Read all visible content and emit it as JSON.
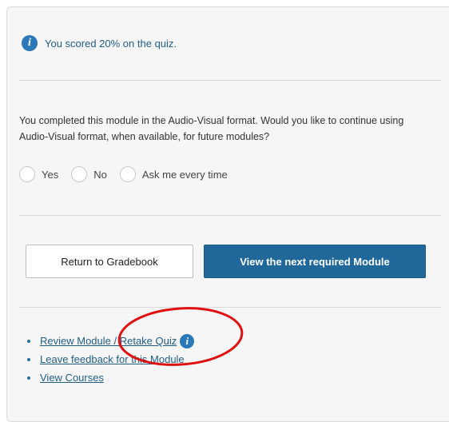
{
  "quiz": {
    "score_text": "You scored 20% on the quiz.",
    "info_icon": "info-icon"
  },
  "format_question": {
    "text": "You completed this module in the Audio-Visual format. Would you like to continue using Audio-Visual format, when available, for future modules?",
    "options": [
      "Yes",
      "No",
      "Ask me every time"
    ]
  },
  "actions": {
    "return_label": "Return to Gradebook",
    "next_label": "View the next required Module"
  },
  "links": [
    {
      "label": "Review Module / Retake Quiz",
      "has_info_icon": true
    },
    {
      "label": "Leave feedback for this Module"
    },
    {
      "label": "View Courses"
    }
  ],
  "annotation": {
    "shape": "ellipse",
    "color": "#e01010",
    "target": "links.0"
  },
  "colors": {
    "accent": "#21689a",
    "link": "#1f5d85",
    "panel": "#f6f6f6"
  }
}
